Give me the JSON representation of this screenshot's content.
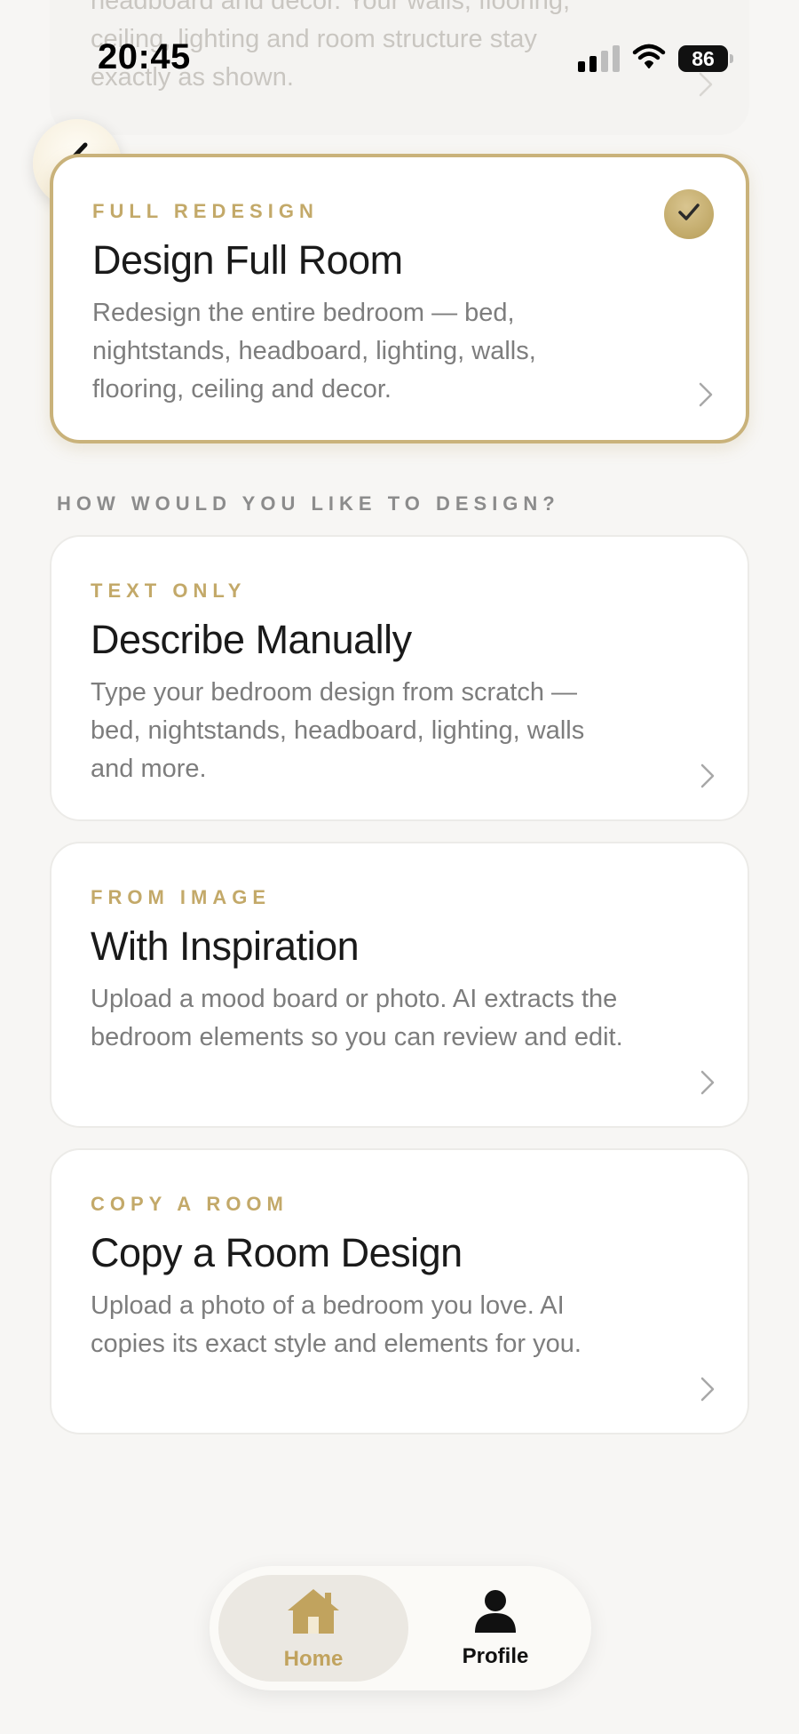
{
  "status_bar": {
    "time": "20:45",
    "battery": "86",
    "icons": [
      "signal-icon",
      "wifi-icon",
      "battery-icon"
    ]
  },
  "previous_card": {
    "description": "headboard and decor. Your walls, flooring, ceiling, lighting and room structure stay exactly as shown."
  },
  "selected_card": {
    "tag": "FULL REDESIGN",
    "title": "Design Full Room",
    "description": "Redesign the entire bedroom — bed, nightstands, headboard, lighting, walls, flooring, ceiling and decor.",
    "selected": true
  },
  "section_label": "HOW WOULD YOU LIKE TO DESIGN?",
  "options": [
    {
      "tag": "TEXT ONLY",
      "title": "Describe Manually",
      "description": "Type your bedroom design from scratch — bed, nightstands, headboard, lighting, walls and more."
    },
    {
      "tag": "FROM IMAGE",
      "title": "With Inspiration",
      "description": "Upload a mood board or photo. AI extracts the bedroom elements so you can review and edit."
    },
    {
      "tag": "COPY A ROOM",
      "title": "Copy a Room Design",
      "description": "Upload a photo of a bedroom you love. AI copies its exact style and elements for you."
    }
  ],
  "tabbar": {
    "home_label": "Home",
    "profile_label": "Profile",
    "active": "Home"
  },
  "colors": {
    "accent_gold": "#c3a969",
    "background": "#f7f6f4",
    "card": "#ffffff"
  }
}
